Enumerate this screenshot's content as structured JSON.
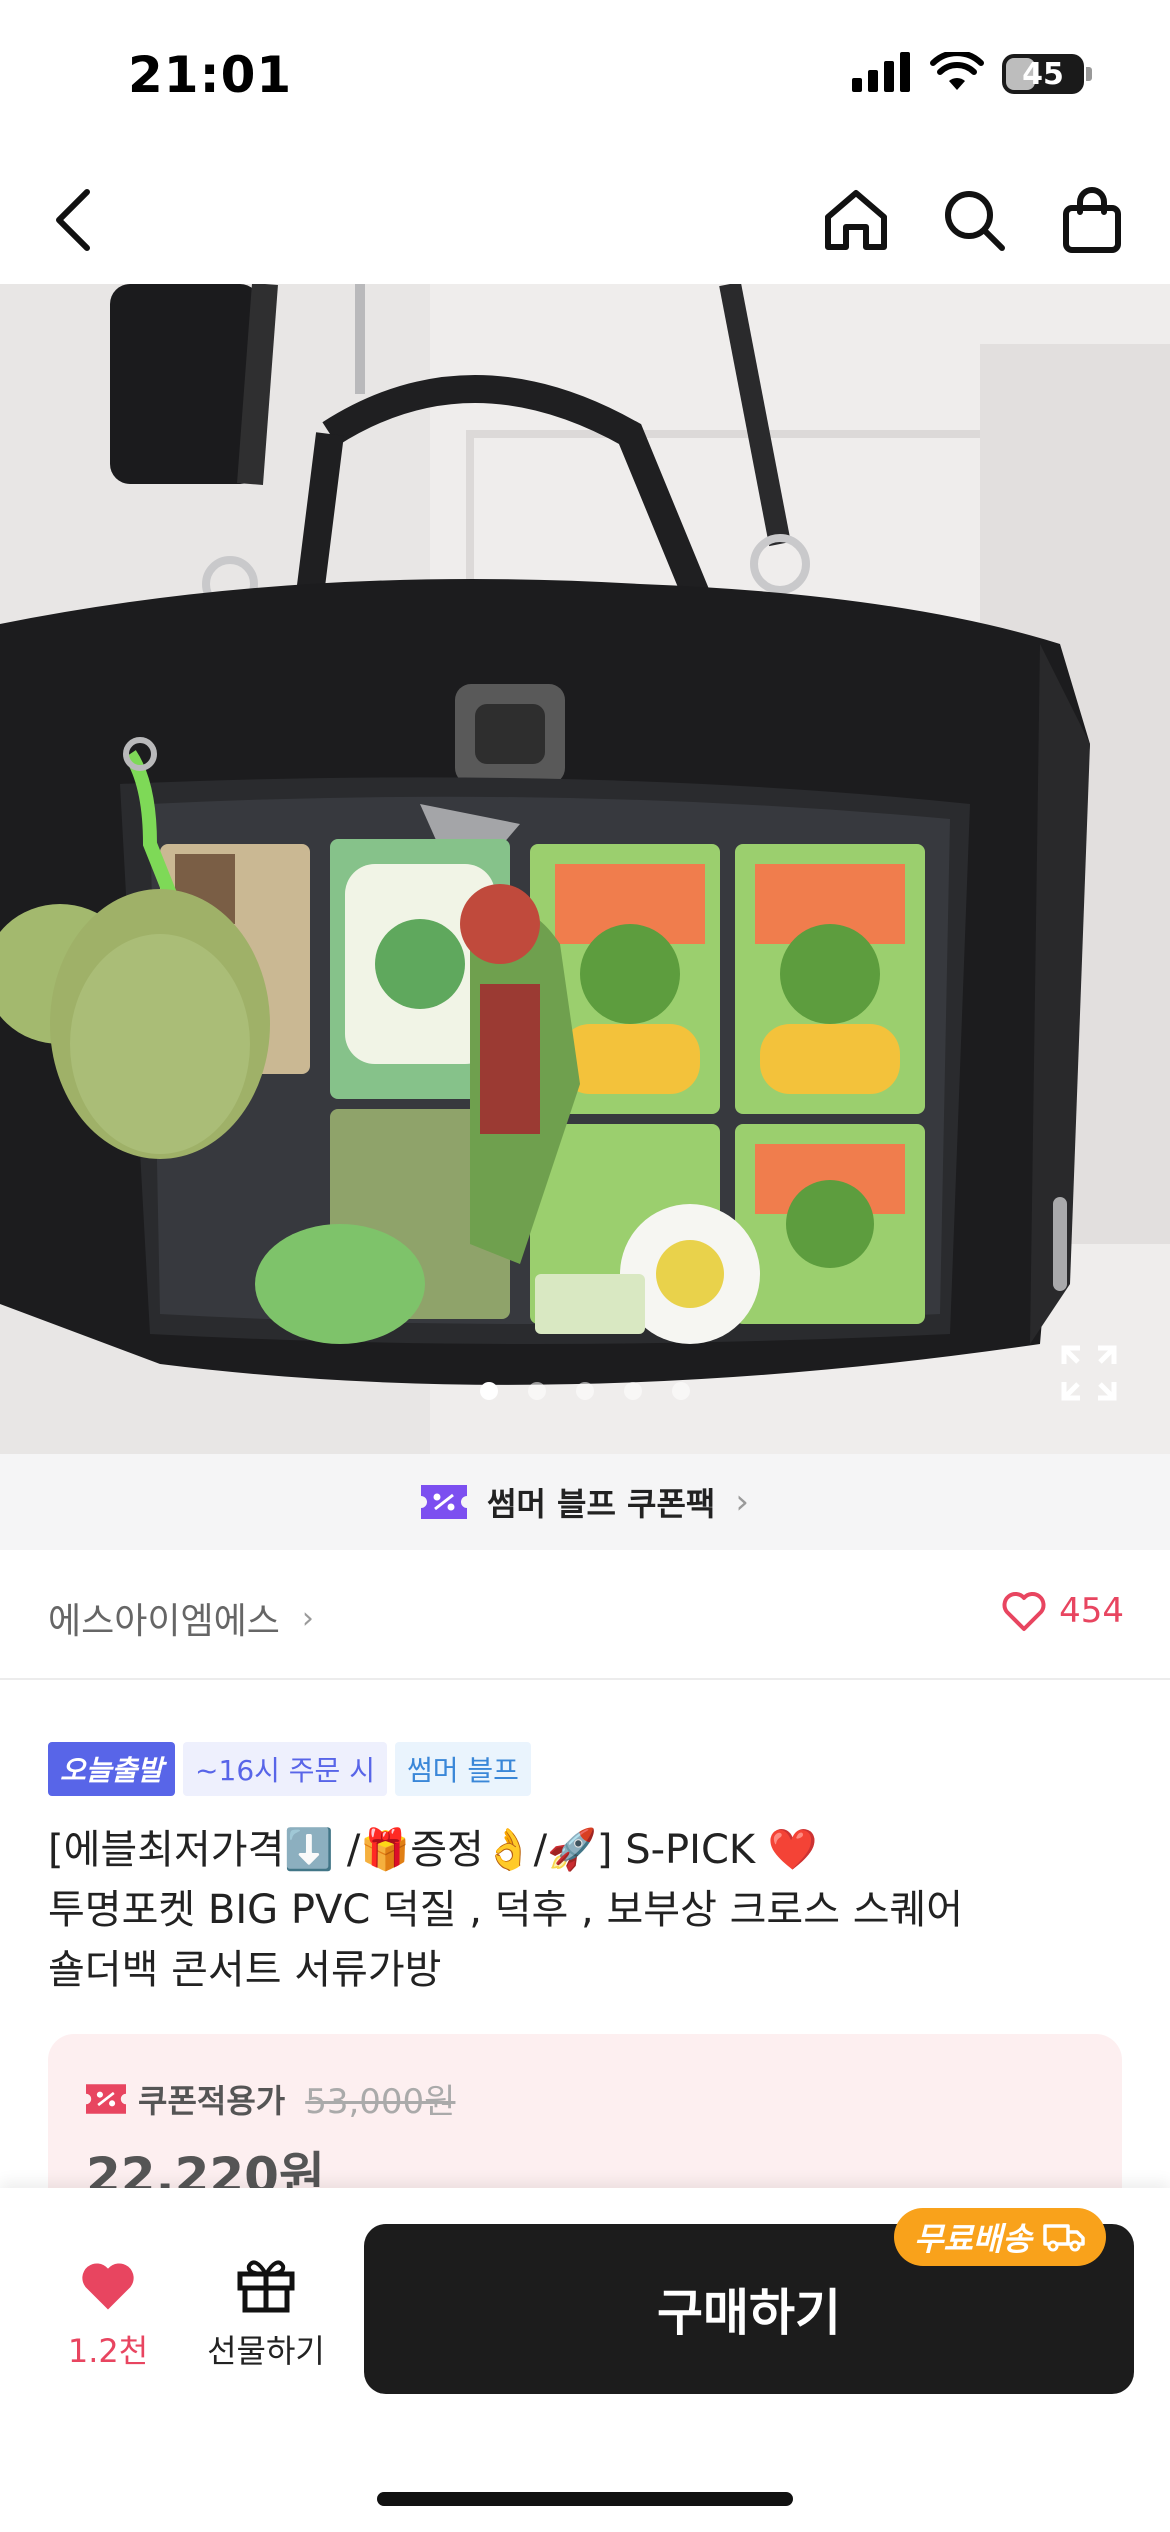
{
  "status_bar": {
    "time": "21:01",
    "battery": "45",
    "battery_level": 0.45
  },
  "nav": {
    "back_icon": "chevron-left-icon",
    "icons": [
      "home-icon",
      "search-icon",
      "shopping-bag-icon"
    ]
  },
  "gallery": {
    "total_images": 5,
    "current_index": 1
  },
  "coupon_pack": {
    "label": "썸머 블프 쿠폰팩",
    "icon": "coupon-icon"
  },
  "seller": {
    "name": "에스아이엠에스",
    "likes": "454"
  },
  "tags": {
    "today": "오늘출발",
    "order_time": "~16시 주문 시",
    "event": "썸머 블프"
  },
  "product": {
    "title_line1": "[에블최저가격⬇️ /🎁증정👌/🚀]  S-PICK ❤️",
    "title_line2": "투명포켓 BIG  PVC 덕질 , 덕후 , 보부상 크로스 스퀘어",
    "title_line3": "숄더백 콘서트 서류가방"
  },
  "price": {
    "coupon_label": "쿠폰적용가",
    "original_price": "53,000원",
    "coupon_price": "22,220원"
  },
  "bottom_bar": {
    "wish_count": "1.2천",
    "gift_label": "선물하기",
    "buy_label": "구매하기",
    "free_shipping": "무료배송"
  },
  "colors": {
    "accent_pink": "#e84560",
    "blue": "#5865e8",
    "orange": "#f9a21b",
    "buy_button": "#1c1c1c"
  }
}
